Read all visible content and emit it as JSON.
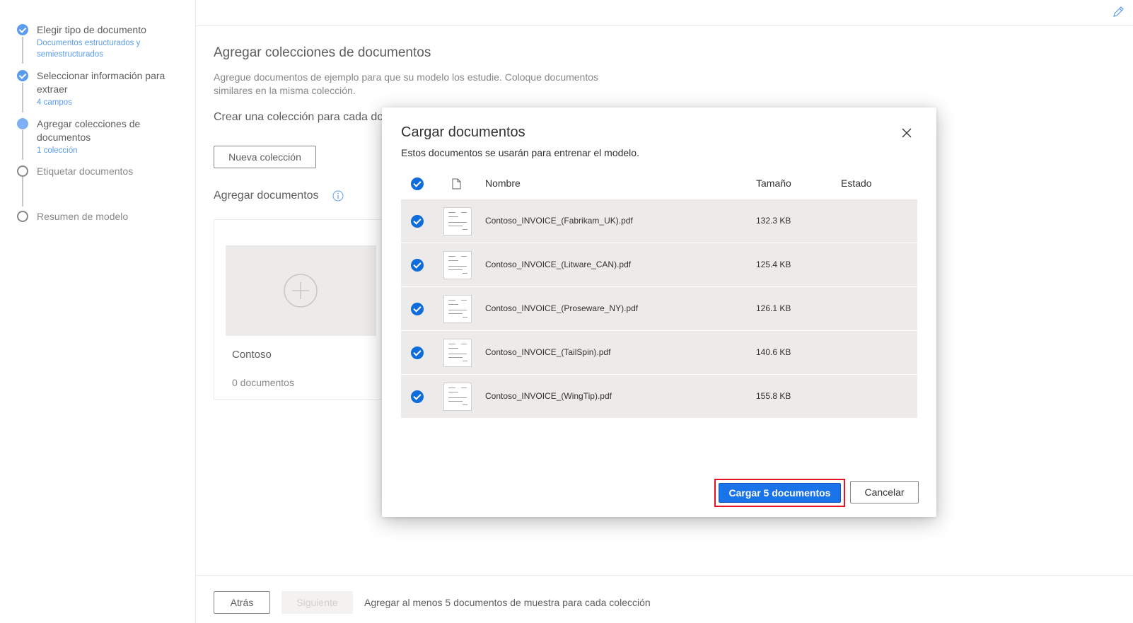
{
  "steps": [
    {
      "title": "Elegir tipo de documento",
      "subtitle": "Documentos estructurados y semiestructurados",
      "state": "done"
    },
    {
      "title": "Seleccionar información para extraer",
      "subtitle": "4 campos",
      "state": "done"
    },
    {
      "title": "Agregar colecciones de documentos",
      "subtitle": "1 colección",
      "state": "current"
    },
    {
      "title": "Etiquetar documentos",
      "subtitle": "",
      "state": "todo"
    },
    {
      "title": "Resumen de modelo",
      "subtitle": "",
      "state": "todo"
    }
  ],
  "main": {
    "title": "Agregar colecciones de documentos",
    "description": "Agregue documentos de ejemplo para que su modelo los estudie. Coloque documentos similares en la misma colección.",
    "subtitle": "Crear una colección para cada do",
    "new_collection_label": "Nueva colección",
    "add_documents_label": "Agregar documentos",
    "collection": {
      "name": "Contoso",
      "count": "0 documentos"
    }
  },
  "footer": {
    "back_label": "Atrás",
    "next_label": "Siguiente",
    "hint": "Agregar al menos 5 documentos de muestra para cada colección"
  },
  "dialog": {
    "title": "Cargar documentos",
    "description": "Estos documentos se usarán para entrenar el modelo.",
    "columns": {
      "name": "Nombre",
      "size": "Tamaño",
      "status": "Estado"
    },
    "files": [
      {
        "name": "Contoso_INVOICE_(Fabrikam_UK).pdf",
        "size": "132.3 KB",
        "status": ""
      },
      {
        "name": "Contoso_INVOICE_(Litware_CAN).pdf",
        "size": "125.4 KB",
        "status": ""
      },
      {
        "name": "Contoso_INVOICE_(Proseware_NY).pdf",
        "size": "126.1 KB",
        "status": ""
      },
      {
        "name": "Contoso_INVOICE_(TailSpin).pdf",
        "size": "140.6 KB",
        "status": ""
      },
      {
        "name": "Contoso_INVOICE_(WingTip).pdf",
        "size": "155.8 KB",
        "status": ""
      }
    ],
    "upload_label": "Cargar 5 documentos",
    "cancel_label": "Cancelar"
  },
  "colors": {
    "accent": "#1a73e8",
    "highlight": "#e81123",
    "step_done": "#5b9cf0"
  }
}
